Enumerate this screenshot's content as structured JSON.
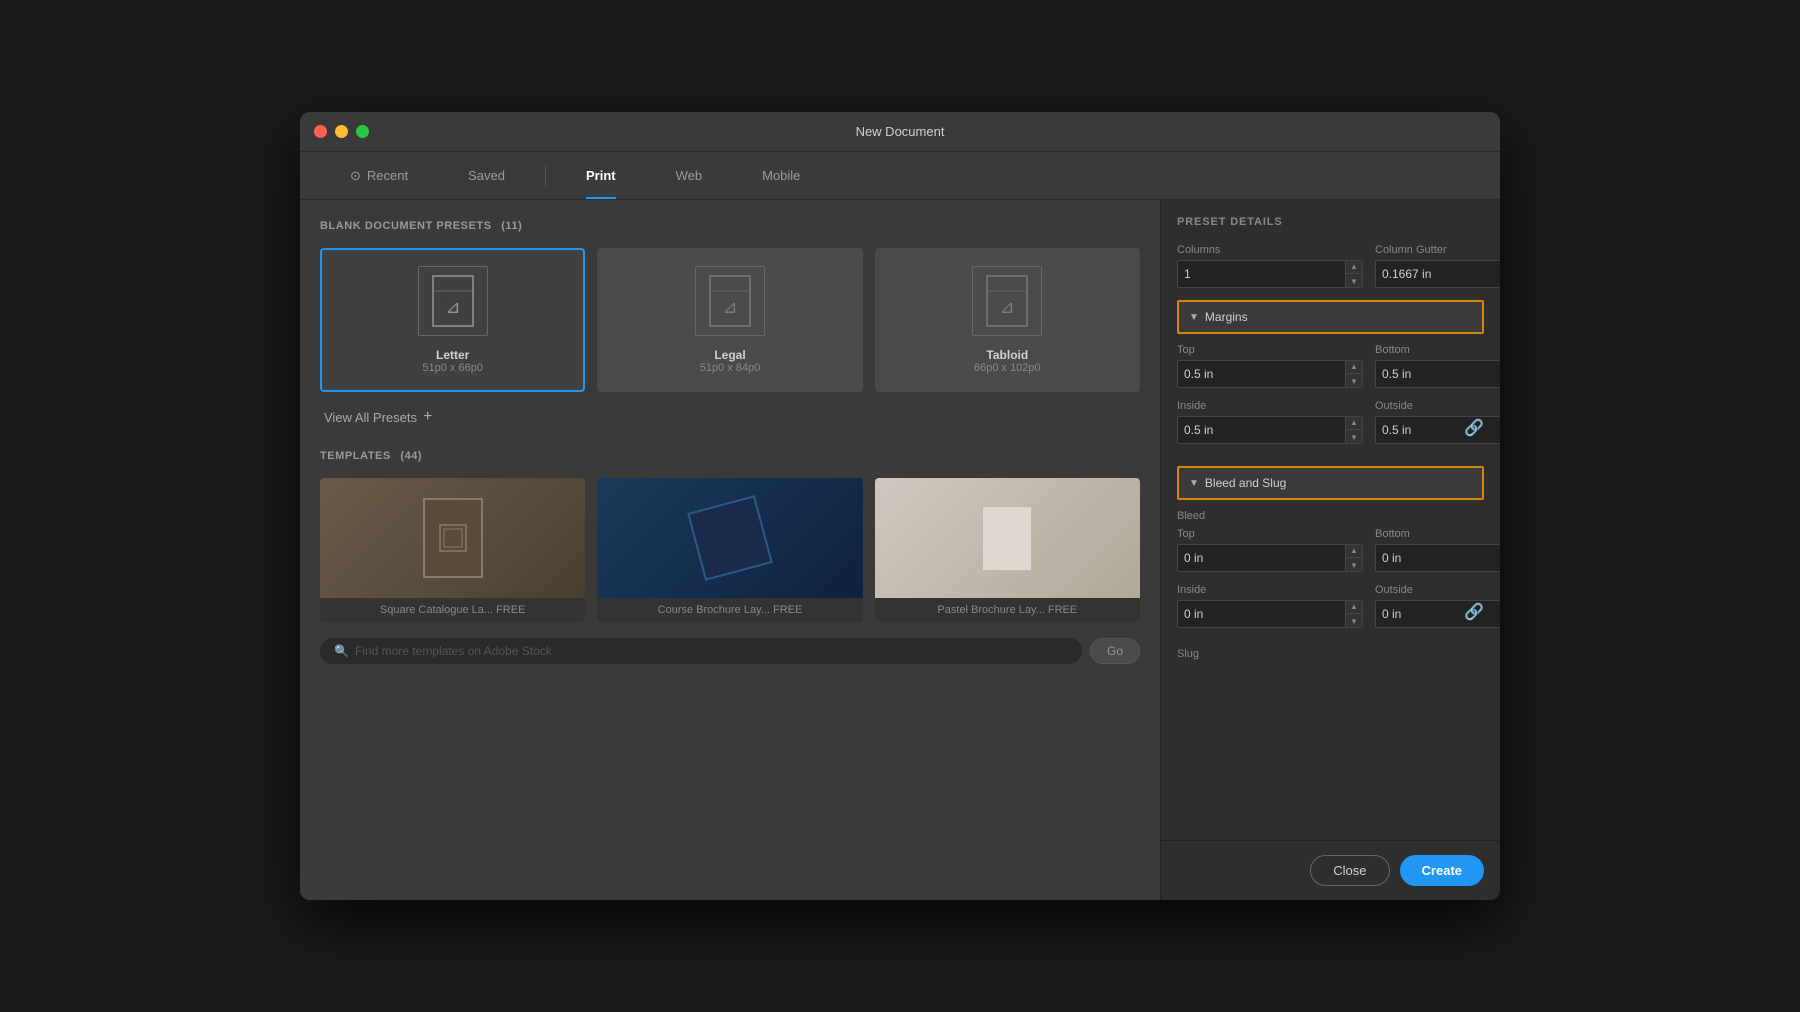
{
  "window": {
    "title": "New Document"
  },
  "tabs": [
    {
      "id": "recent",
      "label": "Recent",
      "icon": "clock"
    },
    {
      "id": "saved",
      "label": "Saved",
      "icon": null
    },
    {
      "id": "print",
      "label": "Print",
      "icon": null,
      "active": true
    },
    {
      "id": "web",
      "label": "Web",
      "icon": null
    },
    {
      "id": "mobile",
      "label": "Mobile",
      "icon": null
    }
  ],
  "left": {
    "presets_header": "BLANK DOCUMENT PRESETS",
    "presets_count": "(11)",
    "presets": [
      {
        "name": "Letter",
        "size": "51p0 x 66p0"
      },
      {
        "name": "Legal",
        "size": "51p0 x 84p0"
      },
      {
        "name": "Tabloid",
        "size": "66p0 x 102p0"
      }
    ],
    "view_all_label": "View All Presets",
    "templates_header": "TEMPLATES",
    "templates_count": "(44)",
    "templates": [
      {
        "name": "Square Catalogue La... FREE"
      },
      {
        "name": "Course Brochure Lay... FREE"
      },
      {
        "name": "Pastel Brochure Lay... FREE"
      }
    ],
    "search_placeholder": "Find more templates on Adobe Stock",
    "go_label": "Go"
  },
  "right": {
    "section_header": "PRESET DETAILS",
    "columns_label": "Columns",
    "columns_value": "1",
    "column_gutter_label": "Column Gutter",
    "column_gutter_value": "0.1667 in",
    "margins": {
      "section_label": "Margins",
      "top_label": "Top",
      "top_value": "0.5 in",
      "bottom_label": "Bottom",
      "bottom_value": "0.5 in",
      "inside_label": "Inside",
      "inside_value": "0.5 in",
      "outside_label": "Outside",
      "outside_value": "0.5 in"
    },
    "bleed_slug": {
      "section_label": "Bleed and Slug",
      "bleed_label": "Bleed",
      "top_label": "Top",
      "top_value": "0 in",
      "bottom_label": "Bottom",
      "bottom_value": "0 in",
      "inside_label": "Inside",
      "inside_value": "0 in",
      "outside_label": "Outside",
      "outside_value": "0 in",
      "slug_label": "Slug"
    },
    "close_label": "Close",
    "create_label": "Create"
  }
}
